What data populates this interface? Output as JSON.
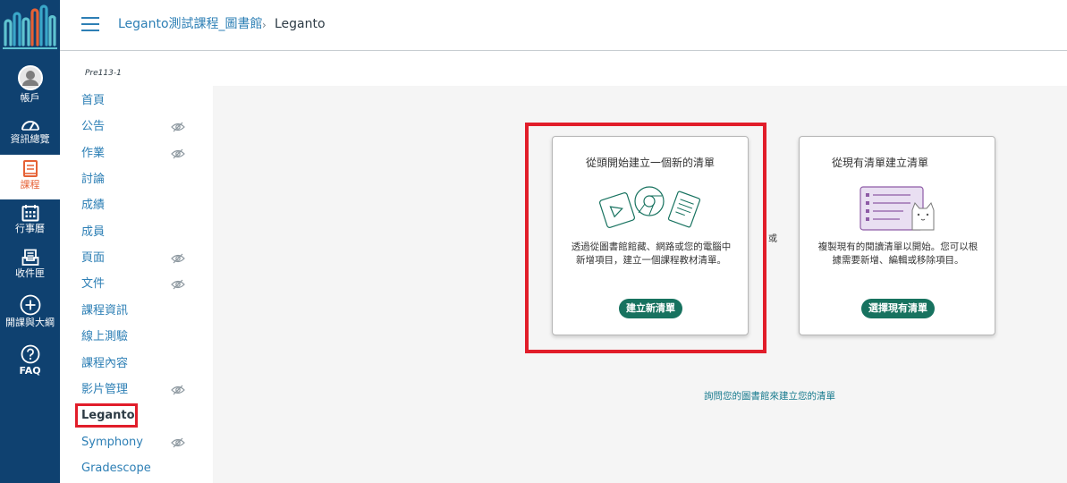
{
  "global_nav": {
    "items": [
      {
        "label": "帳戶",
        "icon": "account-avatar-icon"
      },
      {
        "label": "資訊總覽",
        "icon": "dashboard-gauge-icon"
      },
      {
        "label": "課程",
        "icon": "courses-book-icon"
      },
      {
        "label": "行事曆",
        "icon": "calendar-icon"
      },
      {
        "label": "收件匣",
        "icon": "inbox-icon"
      },
      {
        "label": "開課與大綱",
        "icon": "plus-circle-icon"
      },
      {
        "label": "FAQ",
        "icon": "question-circle-icon"
      }
    ],
    "colors": {
      "background": "#0f4170",
      "active_text": "#e66135",
      "logo_accent": "#5fc3d0"
    }
  },
  "header": {
    "breadcrumb_course": "Leganto測試課程_圖書館",
    "breadcrumb_separator": "›",
    "breadcrumb_current": "Leganto"
  },
  "course_nav": {
    "term": "Pre113-1",
    "items": [
      {
        "label": "首頁",
        "hidden": false
      },
      {
        "label": "公告",
        "hidden": true
      },
      {
        "label": "作業",
        "hidden": true
      },
      {
        "label": "討論",
        "hidden": false
      },
      {
        "label": "成績",
        "hidden": false
      },
      {
        "label": "成員",
        "hidden": false
      },
      {
        "label": "頁面",
        "hidden": true
      },
      {
        "label": "文件",
        "hidden": true
      },
      {
        "label": "課程資訊",
        "hidden": false
      },
      {
        "label": "線上測驗",
        "hidden": false
      },
      {
        "label": "課程內容",
        "hidden": false
      },
      {
        "label": "影片管理",
        "hidden": true
      },
      {
        "label": "Leganto",
        "hidden": false,
        "active": true
      },
      {
        "label": "Symphony",
        "hidden": true
      },
      {
        "label": "Gradescope",
        "hidden": false
      }
    ]
  },
  "main": {
    "new_list_card": {
      "title": "從頭開始建立一個新的清單",
      "description": "透過從圖書館館藏、網路或您的電腦中新增項目，建立一個課程教材清單。",
      "button": "建立新清單"
    },
    "or_label": "或",
    "existing_list_card": {
      "title": "從現有清單建立清單",
      "description": "複製現有的閱讀清單以開始。您可以根據需要新增、編輯或移除項目。",
      "button": "選擇現有清單"
    },
    "ask_library_link": "詢問您的圖書館來建立您的清單",
    "colors": {
      "button": "#17725f",
      "highlight_border": "#e11d2a",
      "link": "#2d7fb5"
    }
  }
}
